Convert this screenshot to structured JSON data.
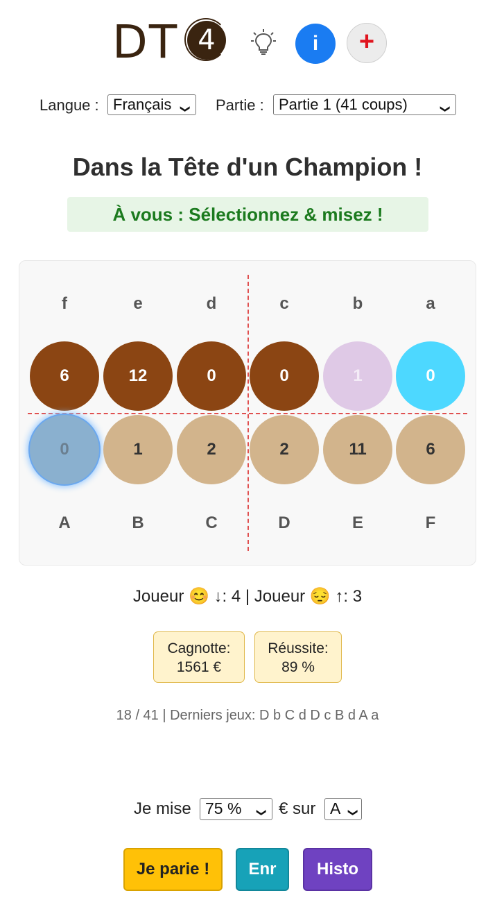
{
  "header": {
    "logo_text": "DT",
    "logo_number": "4",
    "info_label": "i",
    "plus_label": "+"
  },
  "settings": {
    "language_label": "Langue :",
    "language_value": "Français",
    "game_label": "Partie :",
    "game_value": "Partie 1 (41 coups)"
  },
  "title": "Dans la Tête d'un Champion !",
  "status_banner": "À vous : Sélectionnez & misez !",
  "board": {
    "top_labels": [
      "f",
      "e",
      "d",
      "c",
      "b",
      "a"
    ],
    "top_values": [
      "6",
      "12",
      "0",
      "0",
      "1",
      "0"
    ],
    "bottom_values": [
      "0",
      "1",
      "2",
      "2",
      "11",
      "6"
    ],
    "bottom_labels": [
      "A",
      "B",
      "C",
      "D",
      "E",
      "F"
    ],
    "colors": {
      "top_pit": "#8b4513",
      "bottom_pit": "#d2b48c",
      "highlight_top_b": "#dfc9e6",
      "highlight_top_a": "#4dd8ff",
      "selected_bottom_A": "#8ab0cf"
    }
  },
  "players_line": "Joueur 😊 ↓: 4 | Joueur 😔 ↑: 3",
  "stats": {
    "pot_label": "Cagnotte:",
    "pot_value": "1561 €",
    "success_label": "Réussite:",
    "success_value": "89 %"
  },
  "history_line": "18 / 41 | Derniers jeux: D b C d D c B d A a",
  "bet": {
    "prefix": "Je mise",
    "amount_value": "75 %",
    "currency_text": "€ sur",
    "pit_value": "A"
  },
  "buttons": {
    "bet": "Je parie !",
    "save": "Enr",
    "history": "Histo"
  }
}
